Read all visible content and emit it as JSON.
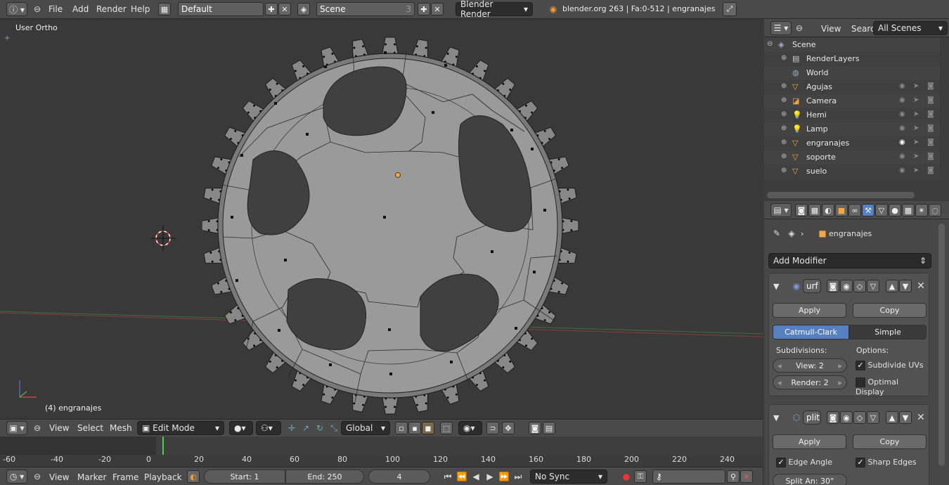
{
  "top_bar": {
    "menus": [
      "File",
      "Add",
      "Render",
      "Help"
    ],
    "layout": "Default",
    "scene": "Scene",
    "scene_count": "3",
    "engine": "Blender Render",
    "stats": "blender.org 263 | Fa:0-512 | engranajes"
  },
  "viewport": {
    "view_label": "User Ortho",
    "object_label": "(4) engranajes"
  },
  "viewport_header": {
    "menus": [
      "View",
      "Select",
      "Mesh"
    ],
    "mode": "Edit Mode",
    "orientation": "Global"
  },
  "timeline": {
    "ticks": [
      "-60",
      "-40",
      "-20",
      "0",
      "20",
      "40",
      "60",
      "80",
      "100",
      "120",
      "140",
      "160",
      "180",
      "200",
      "220",
      "240"
    ],
    "current_frame_marker": 4
  },
  "timeline_header": {
    "menus": [
      "View",
      "Marker",
      "Frame",
      "Playback"
    ],
    "start": "Start: 1",
    "end": "End: 250",
    "current": "4",
    "sync": "No Sync"
  },
  "outliner": {
    "menus": [
      "View",
      "Search"
    ],
    "filter": "All Scenes",
    "items": [
      {
        "label": "Scene",
        "icon": "scene-icon"
      },
      {
        "label": "RenderLayers",
        "icon": "renderlayers-icon"
      },
      {
        "label": "World",
        "icon": "world-icon"
      },
      {
        "label": "Agujas",
        "icon": "mesh-icon"
      },
      {
        "label": "Camera",
        "icon": "camera-icon"
      },
      {
        "label": "Hemi",
        "icon": "lamp-icon"
      },
      {
        "label": "Lamp",
        "icon": "lamp-icon"
      },
      {
        "label": "engranajes",
        "icon": "mesh-icon"
      },
      {
        "label": "soporte",
        "icon": "mesh-icon"
      },
      {
        "label": "suelo",
        "icon": "mesh-icon"
      }
    ]
  },
  "properties": {
    "context_object": "engranajes",
    "add_modifier": "Add Modifier",
    "modifier1": {
      "name": "urf",
      "apply": "Apply",
      "copy": "Copy",
      "tab_a": "Catmull-Clark",
      "tab_b": "Simple",
      "subdivisions_label": "Subdivisions:",
      "options_label": "Options:",
      "view": "View: 2",
      "render": "Render: 2",
      "subdivide_uvs": "Subdivide UVs",
      "optimal_display": "Optimal Display"
    },
    "modifier2": {
      "name": "plit",
      "apply": "Apply",
      "copy": "Copy",
      "edge_angle": "Edge Angle",
      "sharp_edges": "Sharp Edges",
      "split_angle": "Split An: 30°"
    }
  },
  "colors": {
    "accent_blue": "#5680c2",
    "active_object": "#f4a640",
    "grid_x": "#8b3a3a",
    "grid_y": "#3a8b3a"
  }
}
